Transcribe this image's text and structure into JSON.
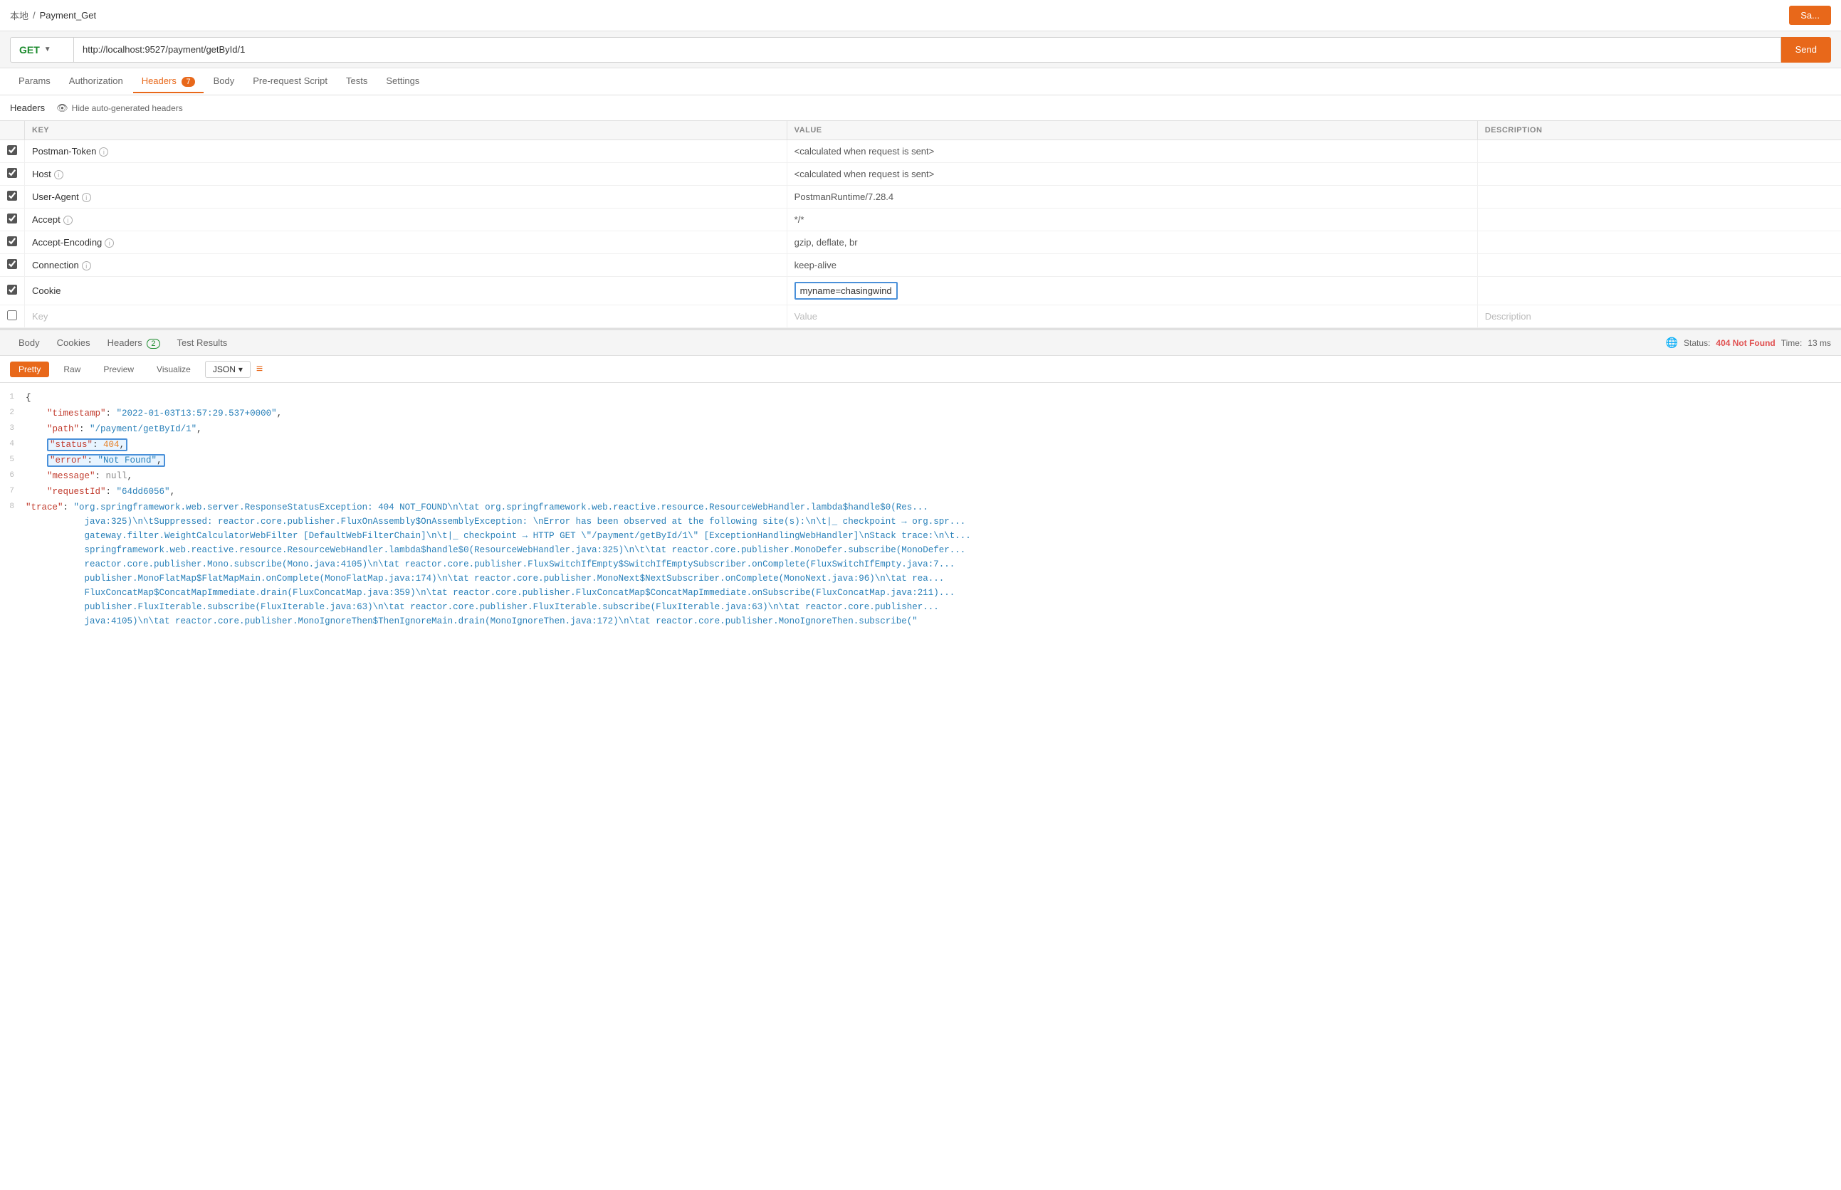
{
  "breadcrumb": {
    "home": "本地",
    "separator": "/",
    "current": "Payment_Get"
  },
  "save_button": "Sa...",
  "url_bar": {
    "method": "GET",
    "url": "http://localhost:9527/payment/getById/1",
    "send_label": "Send"
  },
  "request_tabs": [
    {
      "label": "Params",
      "active": false,
      "badge": null
    },
    {
      "label": "Authorization",
      "active": false,
      "badge": null
    },
    {
      "label": "Headers",
      "active": true,
      "badge": "7"
    },
    {
      "label": "Body",
      "active": false,
      "badge": null
    },
    {
      "label": "Pre-request Script",
      "active": false,
      "badge": null
    },
    {
      "label": "Tests",
      "active": false,
      "badge": null
    },
    {
      "label": "Settings",
      "active": false,
      "badge": null
    }
  ],
  "headers_subbar": {
    "tab_label": "Headers",
    "hide_btn_label": "Hide auto-generated headers"
  },
  "table_headers": {
    "key": "KEY",
    "value": "VALUE",
    "description": "DESCRIPTION"
  },
  "headers_rows": [
    {
      "checked": true,
      "key": "Postman-Token",
      "has_info": true,
      "value": "<calculated when request is sent>",
      "is_placeholder": false,
      "description": ""
    },
    {
      "checked": true,
      "key": "Host",
      "has_info": true,
      "value": "<calculated when request is sent>",
      "is_placeholder": false,
      "description": ""
    },
    {
      "checked": true,
      "key": "User-Agent",
      "has_info": true,
      "value": "PostmanRuntime/7.28.4",
      "is_placeholder": false,
      "description": ""
    },
    {
      "checked": true,
      "key": "Accept",
      "has_info": true,
      "value": "*/*",
      "is_placeholder": false,
      "description": ""
    },
    {
      "checked": true,
      "key": "Accept-Encoding",
      "has_info": true,
      "value": "gzip, deflate, br",
      "is_placeholder": false,
      "description": ""
    },
    {
      "checked": true,
      "key": "Connection",
      "has_info": true,
      "value": "keep-alive",
      "is_placeholder": false,
      "description": ""
    },
    {
      "checked": true,
      "key": "Cookie",
      "has_info": false,
      "value": "myname=chasingwind",
      "is_placeholder": false,
      "description": ""
    }
  ],
  "new_row": {
    "key_placeholder": "Key",
    "value_placeholder": "Value",
    "desc_placeholder": "Description"
  },
  "response_tabs": [
    {
      "label": "Body",
      "active": false,
      "badge": null
    },
    {
      "label": "Cookies",
      "active": false,
      "badge": null
    },
    {
      "label": "Headers",
      "active": false,
      "badge": "2"
    },
    {
      "label": "Test Results",
      "active": false,
      "badge": null
    }
  ],
  "response_status": {
    "status_text": "Status:",
    "code": "404",
    "code_label": "Not Found",
    "time_text": "Time:",
    "time_value": "13 ms"
  },
  "body_toolbar": {
    "views": [
      "Pretty",
      "Raw",
      "Preview",
      "Visualize"
    ],
    "active_view": "Pretty",
    "format": "JSON"
  },
  "json_lines": [
    {
      "num": 1,
      "content": "{",
      "type": "brace"
    },
    {
      "num": 2,
      "key": "timestamp",
      "value": "\"2022-01-03T13:57:29.537+0000\"",
      "type": "string"
    },
    {
      "num": 3,
      "key": "path",
      "value": "\"/payment/getById/1\"",
      "type": "string"
    },
    {
      "num": 4,
      "key": "status",
      "value": "404",
      "type": "number",
      "highlight": true
    },
    {
      "num": 5,
      "key": "error",
      "value": "\"Not Found\"",
      "type": "string",
      "highlight": true
    },
    {
      "num": 6,
      "key": "message",
      "value": "null",
      "type": "null"
    },
    {
      "num": 7,
      "key": "requestId",
      "value": "\"64dd6056\"",
      "type": "string"
    },
    {
      "num": 8,
      "key": "trace",
      "value": "\"org.springframework.web.server.ResponseStatusException: 404 NOT_FOUND\\n\\tat org.springframework.web.reactive.resource.ResourceWebHandler.lambda$handle$0(Res...",
      "type": "string_long"
    }
  ],
  "trace_full": "\"trace\": \"org.springframework.web.server.ResponseStatusException: 404 NOT_FOUND\\n\\tat org.springframework.web.reactive.resource.ResourceWebHandler.lambda$handle$0(Res...java:325)\\n\\tSuppressed: reactor.core.publisher.FluxOnAssembly$OnAssemblyException: \\nError has been observed at the following site(s):\\n\\t|_ checkpoint → org.springframework.gateway.filter.WeightCalculatorWebFilter [DefaultWebFilterChain]\\n\\t|_ checkpoint → HTTP GET \\\"/payment/getById/1\\\" [ExceptionHandlingWebHandler]\\nStack trace:\\n\\t...reactor.core.publisher.MonoDefer.subscribe(MonoDefer...reactor.core.publisher.Mono.subscribe(Mono.java:4105)\\n\\tat reactor.core.publisher.FluxSwitchIfEmpty$SwitchIfEmptySubscriber.onComplete(FluxSwitchIfEmpty.java:7...)publisher.MonoFlatMap$FlatMapMain.onComplete(MonoFlatMap.java:174)\\n\\tat reactor.core.publisher.MonoNext$NextSubscriber.onComplete(MonoNext.java:96)\\n\\tat rea... FluxConcatMap$ConcatMapImmediate.drain(FluxConcatMap.java:359)\\n\\tat reactor.core.publisher.FluxConcatMap$ConcatMapImmediate.onSubscribe(FluxConcatMap.java:211)... publisher.FluxIterable.subscribe(FluxIterable.java:63)\\n\\tat reactor.core.publisher.FluxIterable.subscribe(FluxIterable.java:63)\\n\\tat reactor.core.publisher... java:4105)\\n\\tat reactor.core.publisher.MonoIgnoreThen$ThenIgnoreMain.drain(MonoIgnoreThen.java:172)\\n\\tat reactor.core.publisher.MonoIgnoreThen.subscribe(\""
}
